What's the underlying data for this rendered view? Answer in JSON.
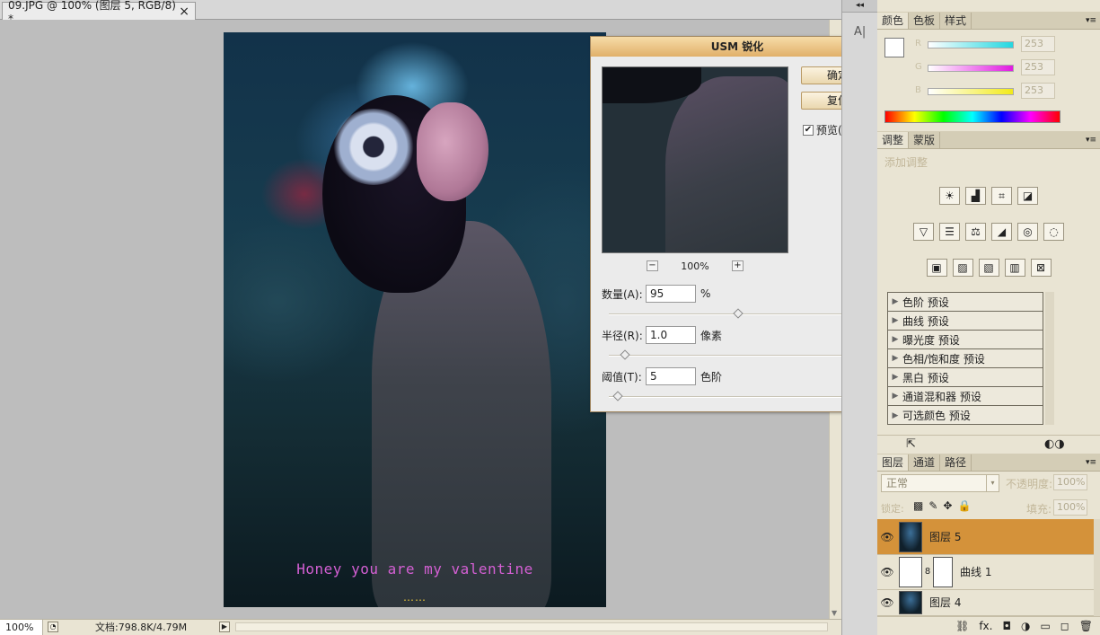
{
  "document": {
    "tab_title": "09.JPG @ 100% (图层 5, RGB/8) *",
    "close_glyph": "×",
    "caption": "Honey you are my valentine",
    "caption_dots": "……"
  },
  "status_bar": {
    "zoom": "100%",
    "doc_info": "文档:798.8K/4.79M",
    "nav_glyph": "▶"
  },
  "dialog": {
    "title": "USM 锐化",
    "close_glyph": "×",
    "ok_label": "确定",
    "reset_label": "复位",
    "preview_label": "预览(P)",
    "preview_checked": true,
    "check_glyph": "✔",
    "zoom_minus": "−",
    "zoom_plus": "+",
    "zoom_level": "100%",
    "amount": {
      "label": "数量(A):",
      "value": "95",
      "unit": "%",
      "slider_fraction": 0.5
    },
    "radius": {
      "label": "半径(R):",
      "value": "1.0",
      "unit": "像素",
      "slider_fraction": 0.05
    },
    "threshold": {
      "label": "阈值(T):",
      "value": "5",
      "unit": "色阶",
      "slider_fraction": 0.02
    }
  },
  "panel_strip": {
    "collapse_glyph": "◂◂",
    "tool_glyph": "A|"
  },
  "color_panel": {
    "tabs": [
      "颜色",
      "色板",
      "样式"
    ],
    "menu_glyph": "▾≡",
    "channels": [
      {
        "label": "R",
        "value": "253",
        "gradient": [
          "#ffffff",
          "#22d7e0"
        ]
      },
      {
        "label": "G",
        "value": "253",
        "gradient": [
          "#ffffff",
          "#e11ae0"
        ]
      },
      {
        "label": "B",
        "value": "253",
        "gradient": [
          "#ffffff",
          "#f2ea18"
        ]
      }
    ]
  },
  "adjustments_panel": {
    "tabs": [
      "调整",
      "蒙版"
    ],
    "menu_glyph": "▾≡",
    "title": "添加调整",
    "icon_rows": [
      [
        "☀",
        "▟",
        "⌗",
        "◪"
      ],
      [
        "▽",
        "☰",
        "⚖",
        "◢",
        "◎",
        "◌"
      ],
      [
        "▣",
        "▨",
        "▧",
        "▥",
        "⊠"
      ]
    ],
    "presets": [
      "色阶 预设",
      "曲线 预设",
      "曝光度 预设",
      "色相/饱和度 预设",
      "黑白 预设",
      "通道混和器 预设",
      "可选颜色 预设"
    ],
    "tri_glyph": "▶",
    "footer_left_glyph": "⇱",
    "footer_right_glyph": "◐◑"
  },
  "layers_panel": {
    "tabs": [
      "图层",
      "通道",
      "路径"
    ],
    "menu_glyph": "▾≡",
    "blend_mode": "正常",
    "dropdown_glyph": "▾",
    "opacity_label": "不透明度:",
    "opacity_value": "100%",
    "lock_label": "锁定:",
    "lock_glyphs": "▩✎✥🔒",
    "fill_label": "填充:",
    "fill_value": "100%",
    "eye_glyph": "👁",
    "link_glyph": "8",
    "layers": [
      {
        "name": "图层 5",
        "selected": true
      },
      {
        "name": "曲线 1",
        "selected": false
      },
      {
        "name": "图层 4",
        "selected": false
      }
    ],
    "footer_glyphs": [
      "⛓",
      "fx.",
      "◘",
      "◑",
      "▭",
      "◻",
      "🗑"
    ]
  }
}
